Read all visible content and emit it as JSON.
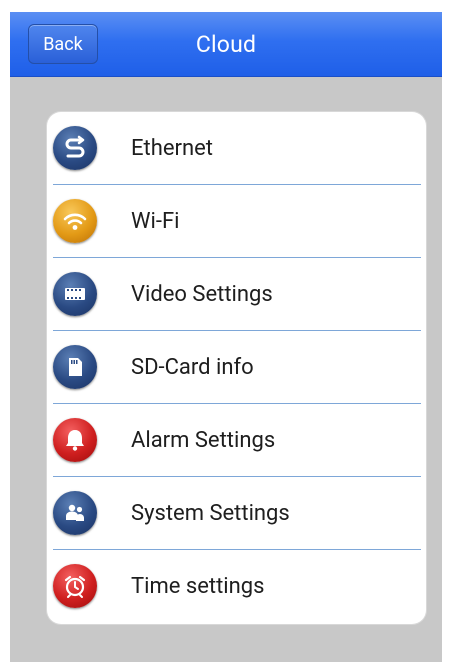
{
  "header": {
    "back_label": "Back",
    "title": "Cloud"
  },
  "menu": {
    "items": [
      {
        "label": "Ethernet",
        "icon": "ethernet-icon",
        "color": "#2a4a83"
      },
      {
        "label": "Wi-Fi",
        "icon": "wifi-icon",
        "color": "#e39a16"
      },
      {
        "label": "Video Settings",
        "icon": "film-icon",
        "color": "#2a4a83"
      },
      {
        "label": "SD-Card info",
        "icon": "sd-card-icon",
        "color": "#2a4a83"
      },
      {
        "label": "Alarm Settings",
        "icon": "bell-icon",
        "color": "#cf1f1f"
      },
      {
        "label": "System Settings",
        "icon": "users-icon",
        "color": "#2a4a83"
      },
      {
        "label": "Time settings",
        "icon": "alarm-clock-icon",
        "color": "#cf1f1f"
      }
    ]
  },
  "colors": {
    "header_blue": "#2f6ff0",
    "background_gray": "#c8c8c8",
    "divider_blue": "#7ea7d8"
  }
}
